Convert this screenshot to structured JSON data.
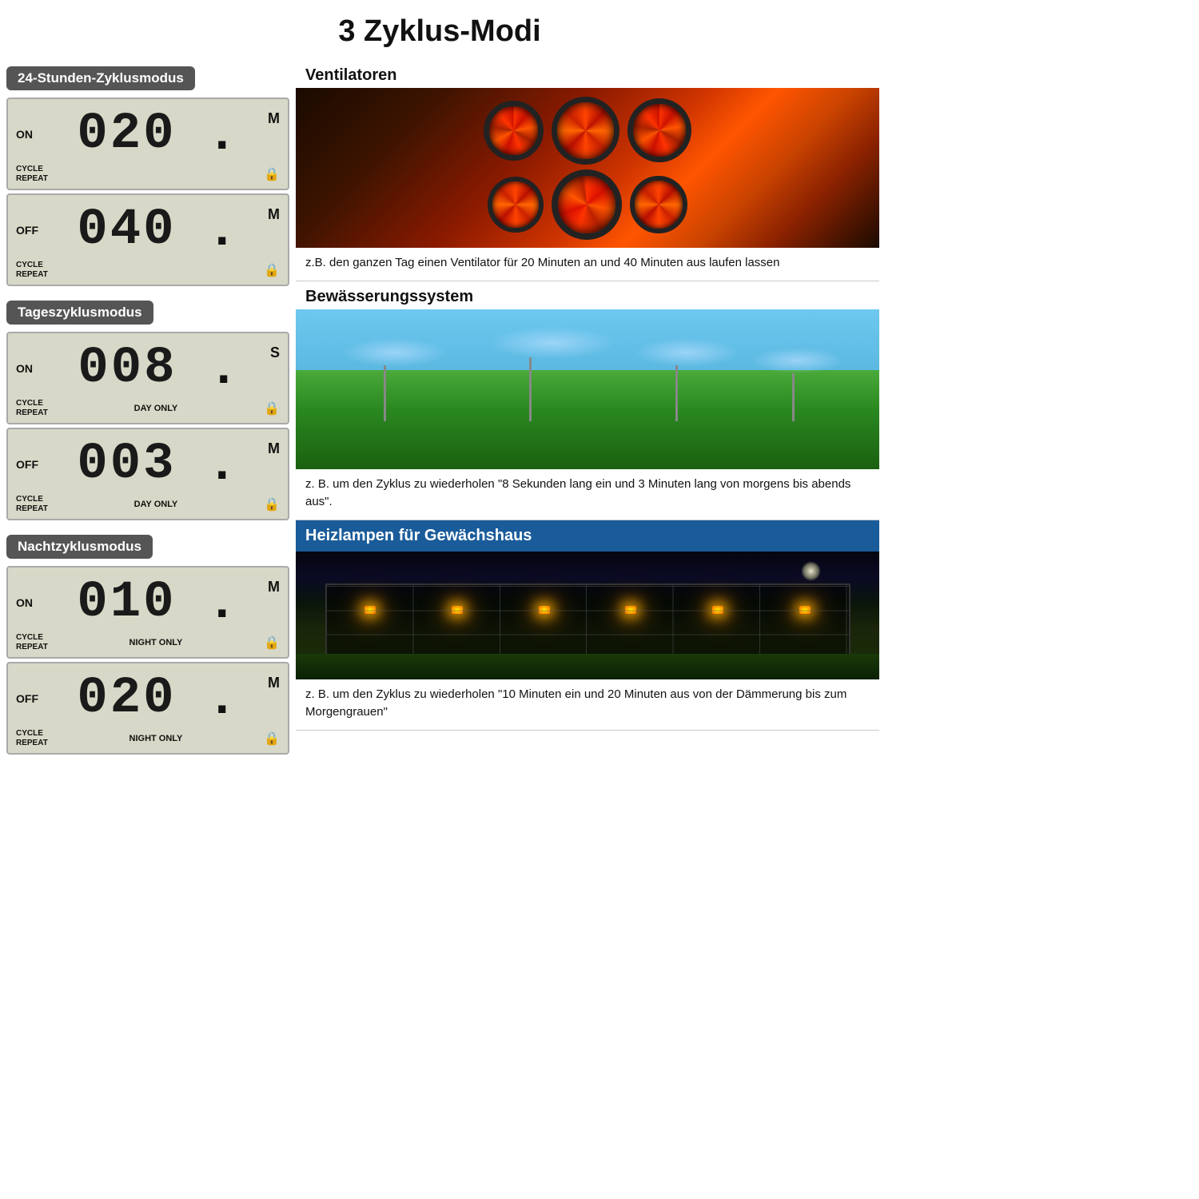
{
  "page": {
    "title": "3 Zyklus-Modi"
  },
  "modes": [
    {
      "id": "24h",
      "label": "24-Stunden-Zyklusmodus",
      "displays": [
        {
          "onoff": "ON",
          "digits": "020",
          "unit": "M",
          "cycle": "CYCLE\nREPEAT",
          "tag": "",
          "has_dot": true
        },
        {
          "onoff": "OFF",
          "digits": "040",
          "unit": "M",
          "cycle": "CYCLE\nREPEAT",
          "tag": "",
          "has_dot": true
        }
      ]
    },
    {
      "id": "day",
      "label": "Tageszyklusmodus",
      "displays": [
        {
          "onoff": "ON",
          "digits": "008",
          "unit": "S",
          "cycle": "CYCLE\nREPEAT",
          "tag": "DAY ONLY",
          "has_dot": true
        },
        {
          "onoff": "OFF",
          "digits": "003",
          "unit": "M",
          "cycle": "CYCLE\nREPEAT",
          "tag": "DAY ONLY",
          "has_dot": true
        }
      ]
    },
    {
      "id": "night",
      "label": "Nachtzyklusmodus",
      "displays": [
        {
          "onoff": "ON",
          "digits": "010",
          "unit": "M",
          "cycle": "CYCLE\nREPEAT",
          "tag": "NIGHT ONLY",
          "has_dot": true
        },
        {
          "onoff": "OFF",
          "digits": "020",
          "unit": "M",
          "cycle": "CYCLE\nREPEAT",
          "tag": "NIGHT ONLY",
          "has_dot": true
        }
      ]
    }
  ],
  "right_sections": [
    {
      "id": "fans",
      "title": "Ventilatoren",
      "is_dark_title": false,
      "description": "z.B. den ganzen Tag einen Ventilator für 20 Minuten an und 40 Minuten aus laufen lassen"
    },
    {
      "id": "irrigation",
      "title": "Bewässerungssystem",
      "is_dark_title": false,
      "description": "z. B. um den Zyklus zu wiederholen \"8 Sekunden lang ein und 3 Minuten lang von morgens bis abends aus\"."
    },
    {
      "id": "greenhouse",
      "title": "Heizlampen für Gewächshaus",
      "is_dark_title": true,
      "description": "z. B. um den Zyklus zu wiederholen \"10 Minuten ein und 20 Minuten aus von der Dämmerung bis zum Morgengrauen\""
    }
  ],
  "lock_icon": "🔒"
}
